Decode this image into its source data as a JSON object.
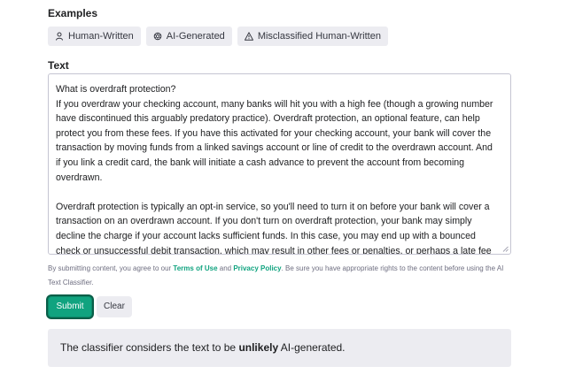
{
  "examples": {
    "label": "Examples",
    "chips": [
      {
        "label": "Human-Written",
        "icon": "person-icon"
      },
      {
        "label": "AI-Generated",
        "icon": "openai-logo-icon"
      },
      {
        "label": "Misclassified Human-Written",
        "icon": "warning-icon"
      }
    ]
  },
  "text": {
    "label": "Text",
    "paragraphs": [
      "What is overdraft protection?\nIf you overdraw your checking account, many banks will hit you with a high fee (though a growing number have discontinued this arguably predatory practice). Overdraft protection, an optional feature, can help protect you from these fees. If you have this activated for your checking account, your bank will cover the transaction by moving funds from a linked savings account or line of credit to the overdrawn account. And if you link a credit card, the bank will initiate a cash advance to prevent the account from becoming overdrawn.",
      "Overdraft protection is typically an opt-in service, so you'll need to turn it on before your bank will cover a transaction on an overdrawn account. If you don't turn on overdraft protection, your bank may simply decline the charge if your account lacks sufficient funds. In this case, you may end up with a bounced check or unsuccessful debit transaction, which may result in other fees or penalties, or perhaps a late fee"
    ]
  },
  "disclaimer": {
    "prefix": "By submitting content, you agree to our ",
    "terms_link": "Terms of Use",
    "and": " and ",
    "privacy_link": "Privacy Policy",
    "suffix": ". Be sure you have appropriate rights to the content before using the AI Text Classifier."
  },
  "buttons": {
    "submit": "Submit",
    "clear": "Clear"
  },
  "result": {
    "prefix": "The classifier considers the text to be ",
    "verdict": "unlikely",
    "suffix": " AI-generated."
  },
  "colors": {
    "accent": "#10a37f",
    "chip_bg": "#ececf1",
    "result_bg": "#ececf1"
  }
}
